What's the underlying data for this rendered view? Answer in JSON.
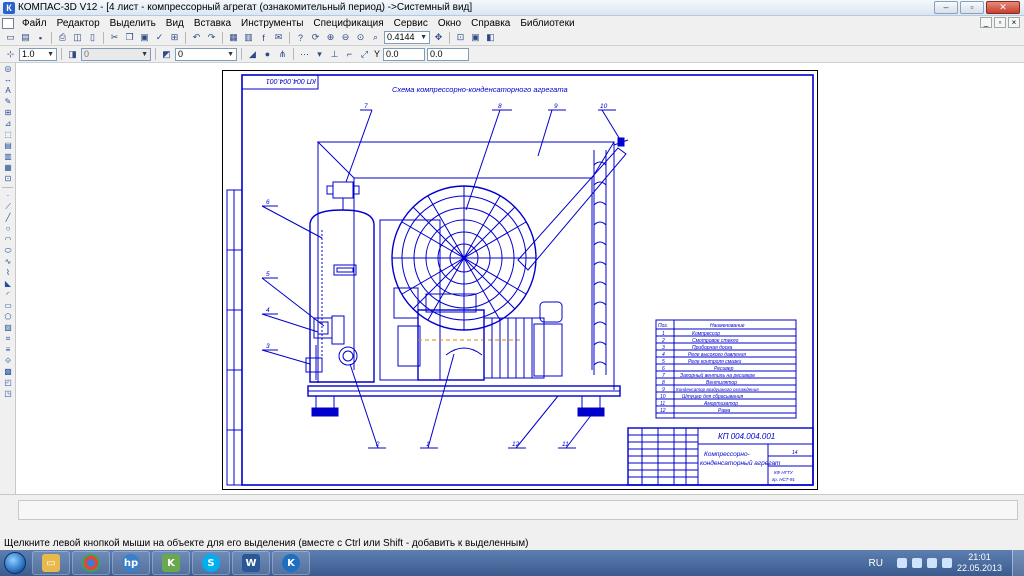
{
  "window": {
    "title": "КОМПАС-3D V12 - [4 лист - компрессорный агрегат (ознакомительный период) ->Системный вид]",
    "app_icon": "К"
  },
  "menu": {
    "items": [
      "Файл",
      "Редактор",
      "Выделить",
      "Вид",
      "Вставка",
      "Инструменты",
      "Спецификация",
      "Сервис",
      "Окно",
      "Справка",
      "Библиотеки"
    ]
  },
  "toolbar": {
    "zoom_value": "0.4144",
    "line_scale": "1.0",
    "layer_value": "0",
    "style_value": "0",
    "y_label": "Y",
    "x_value": "0.0",
    "y_value": "0.0"
  },
  "drawing": {
    "doc_number_rotated": "КП 004.004.001",
    "main_title": "Схема компрессорно-конденсаторного агрегата",
    "callouts": [
      "1",
      "2",
      "3",
      "4",
      "5",
      "6",
      "7",
      "8",
      "9",
      "10",
      "11",
      "12"
    ],
    "spec_table": {
      "headers": [
        "Поз.",
        "Наименование"
      ],
      "rows": [
        [
          "1",
          "Компрессор"
        ],
        [
          "2",
          "Смотровое стекло"
        ],
        [
          "3",
          "Приборная доска"
        ],
        [
          "4",
          "Реле высокого давления"
        ],
        [
          "5",
          "Реле контроля смазки"
        ],
        [
          "6",
          "Ресивер"
        ],
        [
          "7",
          "Запорный вентиль на ресивере"
        ],
        [
          "8",
          "Вентилятор"
        ],
        [
          "9",
          "Конденсатор воздушного охлаждения"
        ],
        [
          "10",
          "Штуцер для сбрасывания"
        ],
        [
          "11",
          "Амортизатор"
        ],
        [
          "12",
          "Рама"
        ]
      ]
    },
    "title_block": {
      "doc_number": "КП 004.004.001",
      "name_line1": "Компрессорно-",
      "name_line2": "конденсаторный агрегат",
      "sheet_count": "14",
      "org_line1": "КФ НГТУ",
      "org_line2": "гр. НСТ-91"
    }
  },
  "status": {
    "hint": "Щелкните левой кнопкой мыши на объекте для его выделения (вместе с Ctrl или Shift - добавить к выделенным)"
  },
  "taskbar": {
    "apps": [
      "explorer",
      "chrome",
      "hp",
      "kompas-3d",
      "skype",
      "word",
      "kompas-k"
    ],
    "language": "RU",
    "time": "21:01",
    "date": "22.05.2013"
  },
  "colors": {
    "drawing_blue": "#0000cc",
    "drawing_orange": "#d98a00",
    "taskbar": "#3b5b8e"
  }
}
